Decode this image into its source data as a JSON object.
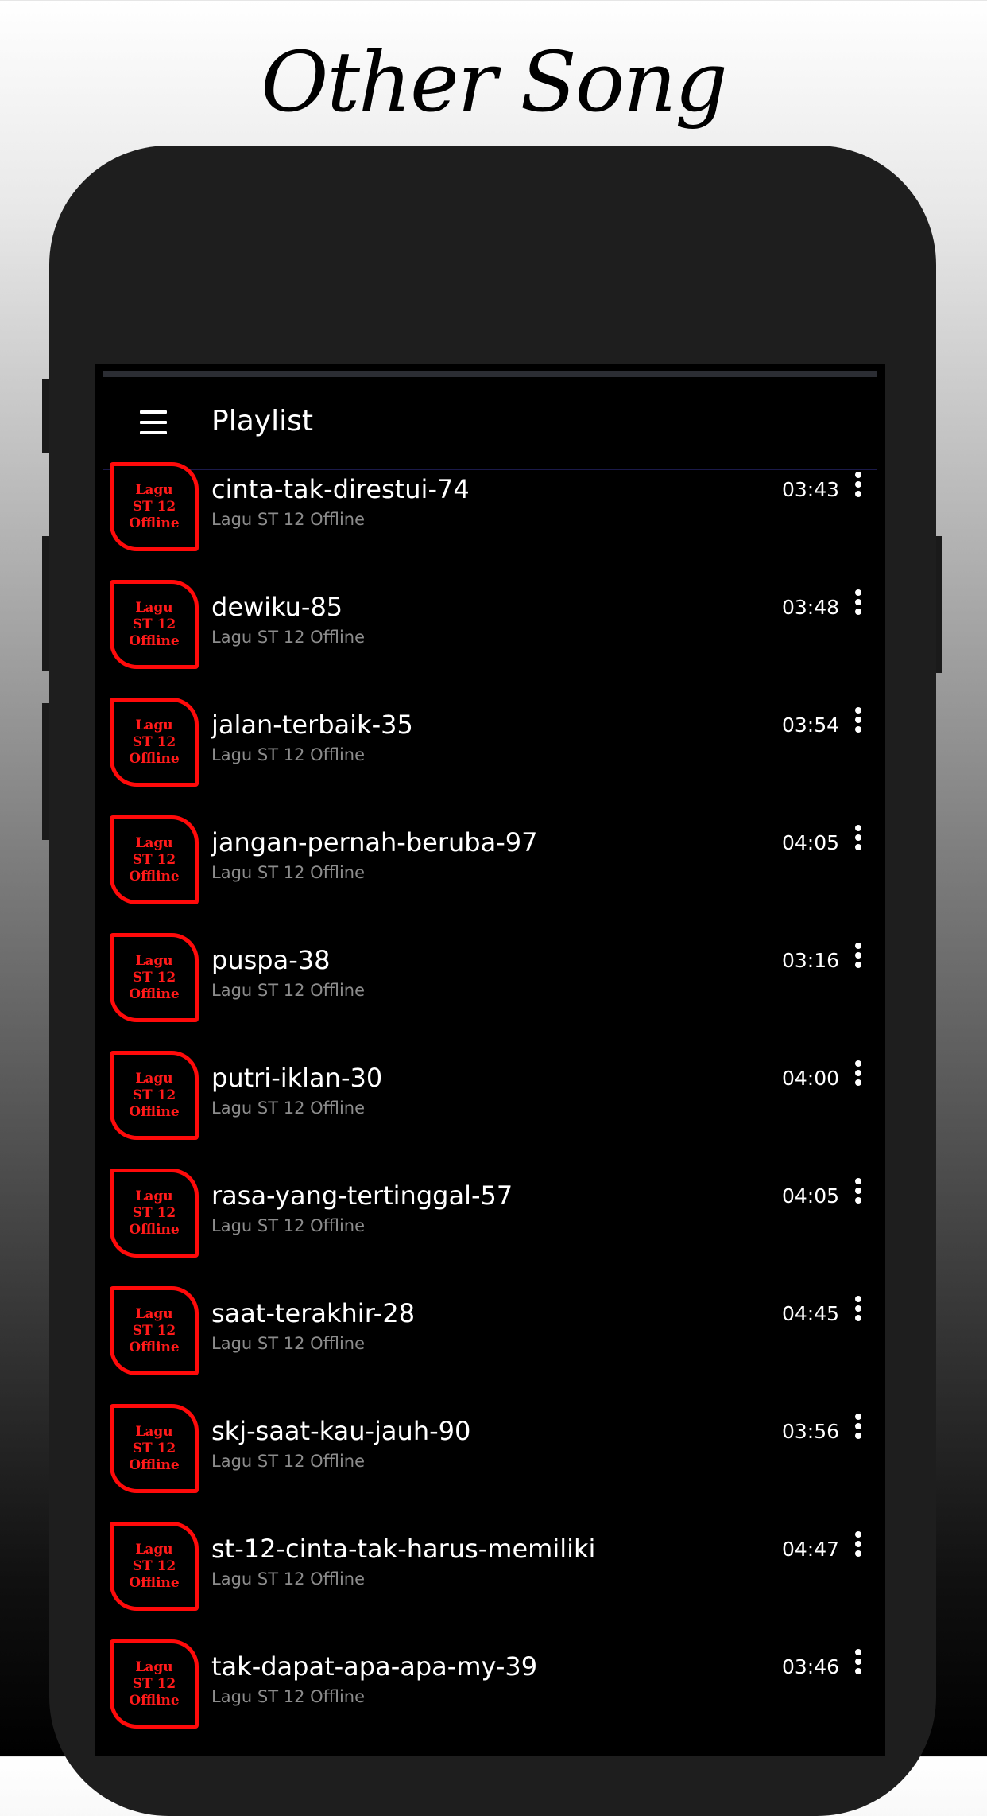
{
  "promo": {
    "title": "Other Song"
  },
  "app_bar": {
    "title": "Playlist",
    "menu_icon": "hamburger-menu-icon"
  },
  "colors": {
    "thumb_accent": "#ff0a0a",
    "background": "#000000",
    "subtitle": "#8c8c8c"
  },
  "songs": [
    {
      "title": "cinta-tak-direstui-74",
      "artist": "Lagu ST 12 Offline",
      "duration": "03:43",
      "thumb_lines": [
        "Lagu",
        "ST 12",
        "Offline"
      ]
    },
    {
      "title": "dewiku-85",
      "artist": "Lagu ST 12 Offline",
      "duration": "03:48",
      "thumb_lines": [
        "Lagu",
        "ST 12",
        "Offline"
      ]
    },
    {
      "title": "jalan-terbaik-35",
      "artist": "Lagu ST 12 Offline",
      "duration": "03:54",
      "thumb_lines": [
        "Lagu",
        "ST 12",
        "Offline"
      ]
    },
    {
      "title": "jangan-pernah-beruba-97",
      "artist": "Lagu ST 12 Offline",
      "duration": "04:05",
      "thumb_lines": [
        "Lagu",
        "ST 12",
        "Offline"
      ]
    },
    {
      "title": "puspa-38",
      "artist": "Lagu ST 12 Offline",
      "duration": "03:16",
      "thumb_lines": [
        "Lagu",
        "ST 12",
        "Offline"
      ]
    },
    {
      "title": "putri-iklan-30",
      "artist": "Lagu ST 12 Offline",
      "duration": "04:00",
      "thumb_lines": [
        "Lagu",
        "ST 12",
        "Offline"
      ]
    },
    {
      "title": "rasa-yang-tertinggal-57",
      "artist": "Lagu ST 12 Offline",
      "duration": "04:05",
      "thumb_lines": [
        "Lagu",
        "ST 12",
        "Offline"
      ]
    },
    {
      "title": "saat-terakhir-28",
      "artist": "Lagu ST 12 Offline",
      "duration": "04:45",
      "thumb_lines": [
        "Lagu",
        "ST 12",
        "Offline"
      ]
    },
    {
      "title": "skj-saat-kau-jauh-90",
      "artist": "Lagu ST 12 Offline",
      "duration": "03:56",
      "thumb_lines": [
        "Lagu",
        "ST 12",
        "Offline"
      ]
    },
    {
      "title": "st-12-cinta-tak-harus-memiliki",
      "artist": "Lagu ST 12 Offline",
      "duration": "04:47",
      "thumb_lines": [
        "Lagu",
        "ST 12",
        "Offline"
      ]
    },
    {
      "title": "tak-dapat-apa-apa-my-39",
      "artist": "Lagu ST 12 Offline",
      "duration": "03:46",
      "thumb_lines": [
        "Lagu",
        "ST 12",
        "Offline"
      ]
    }
  ]
}
